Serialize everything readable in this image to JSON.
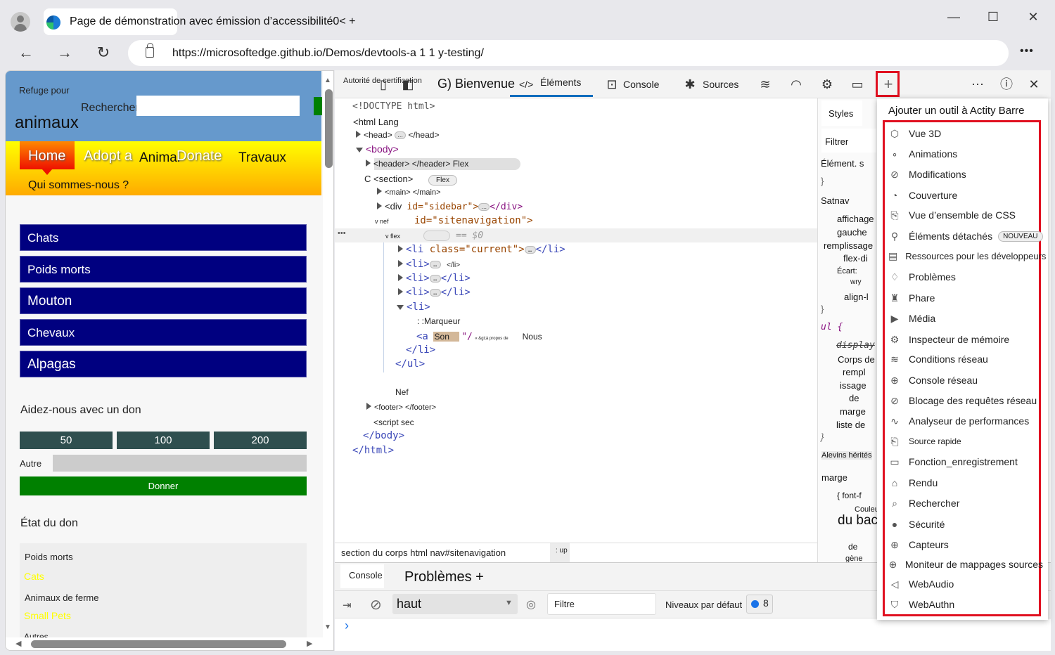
{
  "browser": {
    "tab_title": "Page de démonstration avec émission d’accessibilité0< +",
    "url": "https://microsoftedge.github.io/Demos/devtools-a 1 1 y-testing/",
    "window_controls": [
      "minimize",
      "maximize",
      "close"
    ]
  },
  "page": {
    "site_title_small": "Refuge pour",
    "site_title_big": "animaux",
    "search_label": "Rechercher",
    "search_value": "",
    "nav": [
      "Home",
      "Adopt a",
      "Animal",
      "Donate",
      "Travaux",
      "Qui sommes-nous ?"
    ],
    "categories": [
      "Chats",
      "Poids morts",
      "Mouton",
      "Chevaux",
      "Alpagas"
    ],
    "donate_heading": "Aidez-nous avec un don",
    "amounts": [
      "50",
      "100",
      "200"
    ],
    "other_label": "Autre",
    "other_value": "",
    "donate_button": "Donner",
    "status_heading": "État du don",
    "status_items": [
      {
        "label": "Poids morts",
        "value": "Cats"
      },
      {
        "label": "Animaux de ferme",
        "value": "Small Pets"
      },
      {
        "label": "Autres",
        "value": ""
      }
    ]
  },
  "devtools": {
    "toolbar": {
      "device_label": "Autorité de certification",
      "welcome": "G) Bienvenue",
      "elements": "Éléments",
      "console": "Console",
      "sources": "Sources"
    },
    "dom": {
      "doctype": "<!DOCTYPE html>",
      "html_open": "<html Lang",
      "head": "<head>",
      "head_close": "</head>",
      "body_open": "<body>",
      "header": "<header> </header> Flex",
      "section": "C <section>",
      "flex_badge": "Flex",
      "main": "<main> </main>",
      "div_open": "<div",
      "div_attr": "id=\"sidebar\">",
      "div_close": "</div>",
      "nav_label": "v nef",
      "nav_attr": "id=\"sitenavigation\">",
      "ul_label": "v flex",
      "dollar0": "== $0",
      "li_current": "<li class=\"current\">",
      "li_close": "</li>",
      "li_open": "<li>",
      "li_small_close": "</li>",
      "marker": ": :Marqueur",
      "a_open": "<a",
      "a_highlight": "Son",
      "a_rest": "\"/",
      "a_small": "« &gt;à propos de",
      "a_text": "Nous",
      "ul_close": "</ul>",
      "nef": "Nef",
      "footer": "<footer> </footer>",
      "script": "<script sec",
      "body_close": "</body>",
      "html_close": "</html>"
    },
    "styles": {
      "tab": "Styles",
      "filter": "Filtrer",
      "element_style": "Élément. s",
      "close_brace": "}",
      "selector1": "Satnav",
      "props1": [
        "affichage",
        "gauche",
        "remplissage",
        "flex-di",
        "Écart:",
        "wry",
        "align-l"
      ],
      "selector2": "ul {",
      "props2": [
        "display",
        "Corps de",
        "rempl",
        "issage",
        "de",
        "marge",
        "liste de"
      ],
      "inherited": "Alevins hérités",
      "inherited_sel": "marge",
      "props3": [
        "{ font-f",
        "Couleur",
        "du backer",
        "de",
        "gène"
      ]
    },
    "breadcrumb": "section du corps html nav#sitenavigation",
    "breadcrumb_extra": ": up",
    "drawer": {
      "console_tab": "Console",
      "issues_tab": "Problèmes +",
      "context": "haut",
      "filter_placeholder": "Filtre",
      "levels": "Niveaux par défaut",
      "issue_count": "8",
      "prompt": "›"
    },
    "more_tools_menu": {
      "title": "Ajouter un outil à Actity Barre",
      "items": [
        {
          "label": "Vue 3D",
          "icon": "cube-icon"
        },
        {
          "label": "Animations",
          "icon": "animations-icon"
        },
        {
          "label": "Modifications",
          "icon": "changes-icon"
        },
        {
          "label": "Couverture",
          "icon": "coverage-icon"
        },
        {
          "label": "Vue d’ensemble de CSS",
          "icon": "css-overview-icon"
        },
        {
          "label": "Éléments détachés",
          "icon": "detached-elements-icon",
          "badge": "NOUVEAU"
        },
        {
          "label": "Ressources pour les développeurs",
          "icon": "book-icon"
        },
        {
          "label": "Problèmes",
          "icon": "lightbulb-icon"
        },
        {
          "label": "Phare",
          "icon": "lighthouse-icon"
        },
        {
          "label": "Média",
          "icon": "play-icon"
        },
        {
          "label": "Inspecteur de mémoire",
          "icon": "memory-inspector-icon"
        },
        {
          "label": "Conditions réseau",
          "icon": "network-conditions-icon"
        },
        {
          "label": "Console réseau",
          "icon": "network-console-icon"
        },
        {
          "label": "Blocage des requêtes réseau",
          "icon": "block-icon"
        },
        {
          "label": "Analyseur de performances",
          "icon": "pulse-icon"
        },
        {
          "label": "Source rapide",
          "icon": "quick-source-icon"
        },
        {
          "label": "Fonction_enregistrement",
          "icon": "video-camera-icon"
        },
        {
          "label": "Rendu",
          "icon": "brush-icon"
        },
        {
          "label": "Rechercher",
          "icon": "search-icon"
        },
        {
          "label": "Sécurité",
          "icon": "lock-icon"
        },
        {
          "label": "Capteurs",
          "icon": "globe-icon"
        },
        {
          "label": "Moniteur de mappages sources",
          "icon": "globe-icon"
        },
        {
          "label": "WebAudio",
          "icon": "speaker-icon"
        },
        {
          "label": "WebAuthn",
          "icon": "shield-check-icon"
        }
      ]
    }
  }
}
